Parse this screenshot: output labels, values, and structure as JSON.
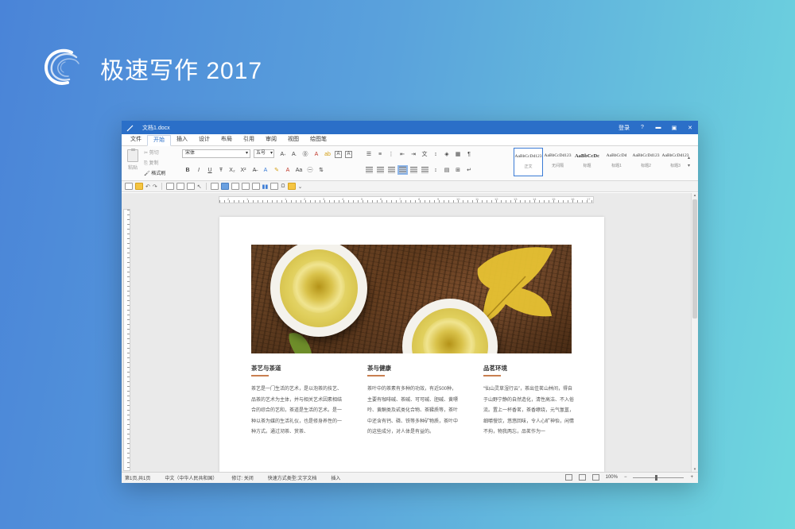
{
  "brand": {
    "title": "极速写作 2017",
    "logo_icon": "c-swirl-logo"
  },
  "window": {
    "doc_name": "文档1.docx",
    "login": "登录",
    "help": "?",
    "minimize": "▬",
    "restore": "▣",
    "close": "✕"
  },
  "menu": {
    "tabs": [
      "文件",
      "开始",
      "插入",
      "设计",
      "布局",
      "引用",
      "审阅",
      "视图",
      "绘图笔"
    ],
    "active": "开始"
  },
  "ribbon": {
    "paste": "粘贴",
    "cut": "剪切",
    "copy": "复制",
    "format_painter": "格式刷",
    "font_name": "宋体",
    "font_size": "五号",
    "styles": [
      {
        "sample": "AaBbCcDd123",
        "label": "正文"
      },
      {
        "sample": "AaBbCcDd123",
        "label": "无间隔"
      },
      {
        "sample": "AaBbCcDc",
        "label": "标题"
      },
      {
        "sample": "AaBbCcDd",
        "label": "标题1"
      },
      {
        "sample": "AaBbCcDd123",
        "label": "标题2"
      },
      {
        "sample": "AaBbCcDd123",
        "label": "标题3"
      }
    ]
  },
  "ruler": {
    "numbers": [
      "2",
      "1",
      "1",
      "2",
      "3",
      "4",
      "5",
      "6",
      "7",
      "8",
      "9",
      "10",
      "11",
      "12",
      "13",
      "14",
      "15",
      "16",
      "17",
      "18"
    ]
  },
  "document": {
    "columns": [
      {
        "title": "茶艺与茶道",
        "body": "茶艺是一门生活的艺术，是以泡茶的技艺、品茶的艺术为主体，并与相关艺术因素相结合的综合的艺和，茶道是生活的艺术。是一种以茶为媒的生活礼仪，也是修身养性的一种方式。通过沏茶、赏茶、"
      },
      {
        "title": "茶与健康",
        "body": "茶叶中的茶素有多种的功效，有近500种，主要有咖啡碱、茶碱、可可碱、胆碱、黄嘌呤、黄酮类及甙类化合物、茶鞣质等，茶叶中还含有钙、磷、铁等多种矿物质，茶叶中的这些成分，对人体是有益的。"
      },
      {
        "title": "品茗环境",
        "body": "“仙山灵草湿行云”，茶出佳茗山林间，得自于山野宁静的自然造化，清性高洁、不入俗流。置上一杯香茗，茶香缭绕，元气氤氲，细嚼慢饮，悠悠回味，令人心旷神怡，闲情不拘，物我两忘，品茗作为一"
      }
    ]
  },
  "status": {
    "page": "第1页,共1页",
    "language": "中文（中华人民共和国）",
    "track": "修订: 关闭",
    "mode": "快速方式类型:文字文档",
    "insert": "插入",
    "zoom": "100%"
  }
}
